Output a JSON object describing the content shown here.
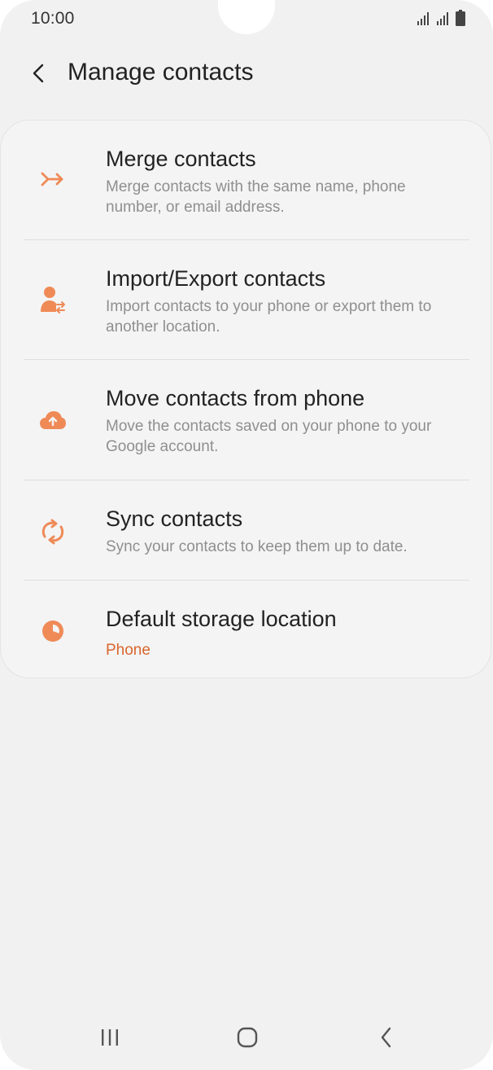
{
  "status_bar": {
    "time": "10:00"
  },
  "header": {
    "title": "Manage contacts"
  },
  "colors": {
    "accent": "#ef8a57",
    "accent_text": "#d9662c",
    "background": "#f1f1f1"
  },
  "items": [
    {
      "title": "Merge contacts",
      "subtitle": "Merge contacts with the same name, phone number, or email address.",
      "icon": "merge-icon"
    },
    {
      "title": "Import/Export contacts",
      "subtitle": "Import contacts to your phone or export them to another location.",
      "icon": "import-export-icon"
    },
    {
      "title": "Move contacts from phone",
      "subtitle": "Move the contacts saved on your phone to your Google account.",
      "icon": "cloud-upload-icon"
    },
    {
      "title": "Sync contacts",
      "subtitle": "Sync your contacts to keep them up to date.",
      "icon": "sync-icon"
    },
    {
      "title": "Default storage location",
      "subtitle": "Phone",
      "icon": "storage-pie-icon"
    }
  ],
  "nav_bar": {
    "buttons": [
      "recent-apps-icon",
      "home-icon",
      "back-icon"
    ]
  }
}
